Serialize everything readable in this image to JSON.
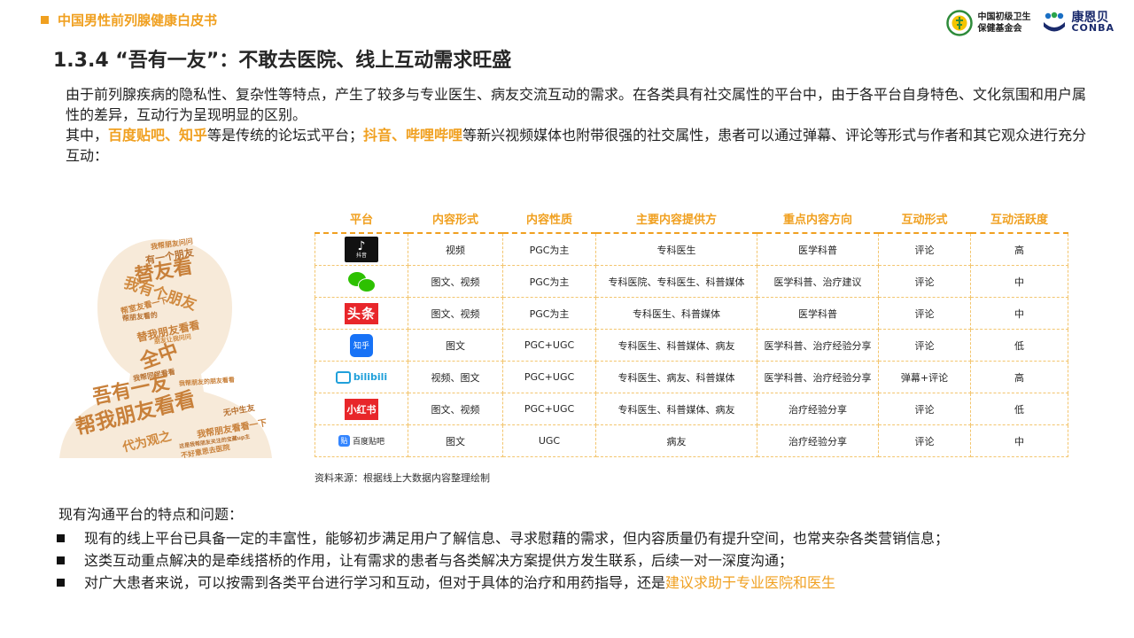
{
  "header": {
    "report_title": "中国男性前列腺健康白皮书",
    "page_title": "1.3.4 “吾有一友”：不敢去医院、线上互动需求旺盛",
    "logo1_lines": [
      "中国初级卫生",
      "保健基金会"
    ],
    "logo2_cn": "康恩贝",
    "logo2_en": "CONBA"
  },
  "intro": {
    "p1": "由于前列腺疾病的隐私性、复杂性等特点，产生了较多与专业医生、病友交流互动的需求。在各类具有社交属性的平台中，由于各平台自身特色、文化氛围和用户属性的差异，互动行为呈现明显的区别。",
    "p2_a": "其中，",
    "p2_hl1": "百度贴吧、知乎",
    "p2_b": "等是传统的论坛式平台；",
    "p2_hl2": "抖音、哔哩哔哩",
    "p2_c": "等新兴视频媒体也附带很强的社交属性，患者可以通过弹幕、评论等形式与作者和其它观众进行充分互动："
  },
  "word_cloud": [
    "我帮朋友问问",
    "有一个朋友",
    "替友看",
    "我有个朋友",
    "帮室友看一下",
    "帮朋友看的",
    "替我朋友看看",
    "朋友让我问问",
    "全中",
    "我帮同学看看",
    "我帮朋友的朋友看看",
    "吾有一友",
    "帮我朋友看看",
    "无中生友",
    "我帮朋友看看一下",
    "代为观之",
    "这是我帮朋友关注的宝藏up主",
    "不好意思去医院"
  ],
  "table": {
    "headers": [
      "平台",
      "内容形式",
      "内容性质",
      "主要内容提供方",
      "重点内容方向",
      "互动形式",
      "互动活跃度"
    ],
    "rows": [
      {
        "platform": "抖音",
        "icon": "douyin-logo",
        "cells": [
          "视频",
          "PGC为主",
          "专科医生",
          "医学科普",
          "评论",
          "高"
        ]
      },
      {
        "platform": "微信",
        "icon": "wechat-logo",
        "cells": [
          "图文、视频",
          "PGC为主",
          "专科医院、专科医生、科普媒体",
          "医学科普、治疗建议",
          "评论",
          "中"
        ]
      },
      {
        "platform": "头条",
        "icon": "toutiao-logo",
        "cells": [
          "图文、视频",
          "PGC为主",
          "专科医生、科普媒体",
          "医学科普",
          "评论",
          "中"
        ]
      },
      {
        "platform": "知乎",
        "icon": "zhihu-logo",
        "cells": [
          "图文",
          "PGC+UGC",
          "专科医生、科普媒体、病友",
          "医学科普、治疗经验分享",
          "评论",
          "低"
        ]
      },
      {
        "platform": "bilibili",
        "icon": "bilibili-logo",
        "cells": [
          "视频、图文",
          "PGC+UGC",
          "专科医生、病友、科普媒体",
          "医学科普、治疗经验分享",
          "弹幕+评论",
          "高"
        ]
      },
      {
        "platform": "小红书",
        "icon": "xiaohongshu-logo",
        "cells": [
          "图文、视频",
          "PGC+UGC",
          "专科医生、科普媒体、病友",
          "治疗经验分享",
          "评论",
          "低"
        ]
      },
      {
        "platform": "百度贴吧",
        "icon": "tieba-logo",
        "cells": [
          "图文",
          "UGC",
          "病友",
          "治疗经验分享",
          "评论",
          "中"
        ]
      }
    ],
    "source": "资料来源：根据线上大数据内容整理绘制"
  },
  "bottom": {
    "title": "现有沟通平台的特点和问题：",
    "b1": "现有的线上平台已具备一定的丰富性，能够初步满足用户了解信息、寻求慰藉的需求，但内容质量仍有提升空间，也常夹杂各类营销信息；",
    "b2": "这类互动重点解决的是牵线搭桥的作用，让有需求的患者与各类解决方案提供方发生联系，后续一对一深度沟通；",
    "b3_a": "对广大患者来说，可以按需到各类平台进行学习和互动，但对于具体的治疗和用药指导，还是",
    "b3_hl": "建议求助于专业医院和医生"
  },
  "colors": {
    "accent": "#f0a020",
    "cloud": "#c8803a",
    "table_border": "#f3c56e"
  }
}
